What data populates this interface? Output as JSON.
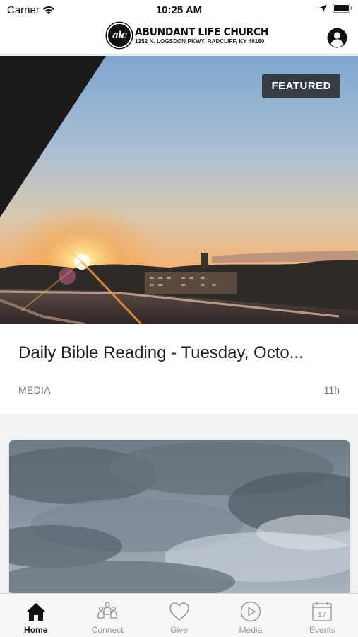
{
  "status_bar": {
    "carrier": "Carrier",
    "time": "10:25 AM"
  },
  "header": {
    "logo_mark": "alc",
    "church_name": "ABUNDANT LIFE CHURCH",
    "address": "1352 N. LOGSDON PKWY, RADCLIFF, KY 40160",
    "profile_icon": "user-circle-icon"
  },
  "featured": {
    "badge": "FEATURED",
    "title": "Daily Bible Reading - Tuesday, Octo...",
    "category": "MEDIA",
    "time_ago": "11h",
    "image": "sunset over rooftop"
  },
  "second_card": {
    "image": "cloudy sky"
  },
  "tabs": [
    {
      "label": "Home",
      "icon": "home-icon",
      "active": true
    },
    {
      "label": "Connect",
      "icon": "people-icon",
      "active": false
    },
    {
      "label": "Give",
      "icon": "heart-icon",
      "active": false
    },
    {
      "label": "Media",
      "icon": "play-circle-icon",
      "active": false
    },
    {
      "label": "Events",
      "icon": "calendar-icon",
      "active": false
    }
  ],
  "colors": {
    "active_tab": "#111111",
    "inactive_tab": "#9a9a9a",
    "badge_bg": "#2c3034"
  }
}
